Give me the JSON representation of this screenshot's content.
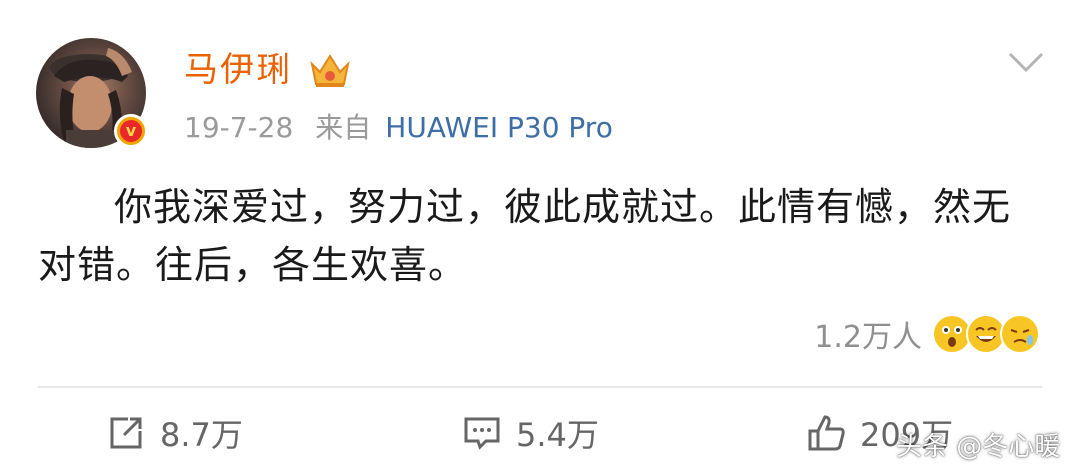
{
  "header": {
    "username": "马伊琍",
    "date": "19-7-28",
    "source_prefix": "来自",
    "source_device": "HUAWEI P30 Pro"
  },
  "post": {
    "text": "你我深爱过，努力过，彼此成就过。此情有憾，然无对错。往后，各生欢喜。"
  },
  "reactions": {
    "count": "1.2万人",
    "icons": [
      "shocked-emoji",
      "laughing-emoji",
      "crying-emoji"
    ]
  },
  "actions": {
    "repost": {
      "label": "8.7万",
      "icon": "repost-icon"
    },
    "comment": {
      "label": "5.4万",
      "icon": "comment-icon"
    },
    "like": {
      "label": "209万",
      "icon": "thumbs-up-icon"
    }
  },
  "watermark": "头条 @冬心暖",
  "colors": {
    "username": "#eb6100",
    "source": "#3d6ea6",
    "meta": "#9a9a9a",
    "badge": "#f2a400"
  }
}
